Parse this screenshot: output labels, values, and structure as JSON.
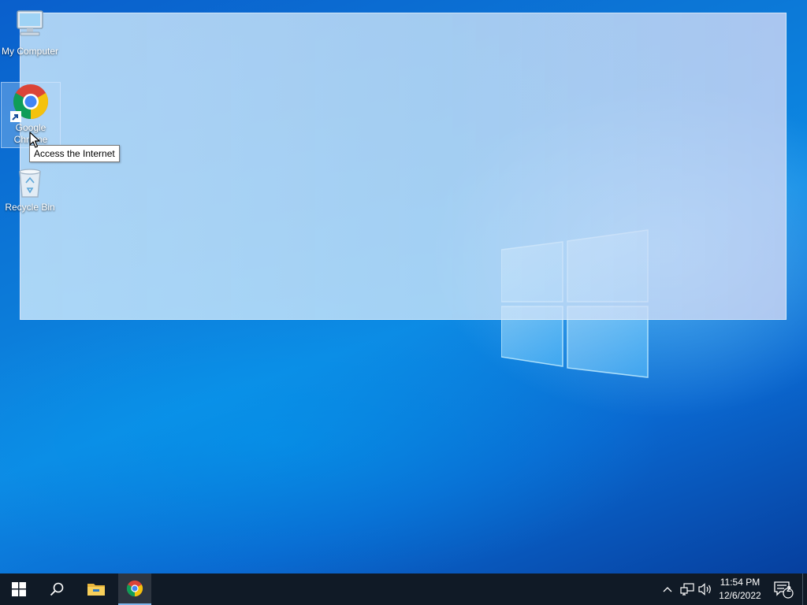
{
  "desktop": {
    "icons": [
      {
        "label": "My Computer",
        "icon": "computer-icon"
      },
      {
        "label": "Google Chrome",
        "icon": "chrome-icon",
        "selected": true
      },
      {
        "label": "Recycle Bin",
        "icon": "recycle-bin-icon"
      }
    ],
    "tooltip": "Access the Internet"
  },
  "taskbar": {
    "start_icon": "windows-start-icon",
    "search_icon": "search-icon",
    "pinned": [
      {
        "name": "File Explorer",
        "icon": "folder-icon"
      },
      {
        "name": "Google Chrome",
        "icon": "chrome-icon",
        "active": true
      }
    ],
    "tray": {
      "chevron_icon": "chevron-up-icon",
      "network_icon": "network-icon",
      "volume_icon": "volume-icon"
    },
    "clock": {
      "time": "11:54 PM",
      "date": "12/6/2022"
    },
    "notifications": {
      "count": "2",
      "icon": "notification-icon"
    }
  },
  "colors": {
    "taskbar_bg": "#101a26",
    "desktop_blue": "#0c7ad8",
    "overlay": "#d7f0ff"
  }
}
